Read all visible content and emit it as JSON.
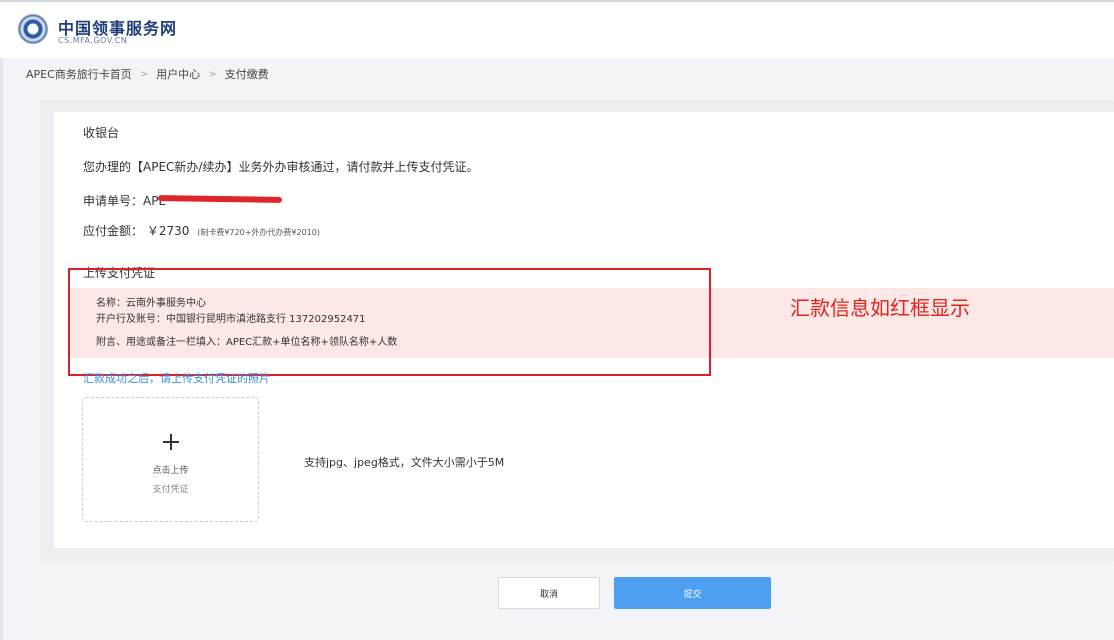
{
  "header": {
    "site_title": "中国领事服务网",
    "site_subtitle": "CS.MFA.GOV.CN"
  },
  "breadcrumb": [
    "APEC商务旅行卡首页",
    "用户中心",
    "支付缴费"
  ],
  "page": {
    "section_title": "收银台",
    "notice": "您办理的【APEC新办/续办】业务外办审核通过，请付款并上传支付凭证。",
    "order_label": "申请单号：APE",
    "amount_label": "应付金额：",
    "amount_value": "￥2730",
    "amount_detail": "(制卡费¥720+外办代办费¥2010)",
    "upload_section_title": "上传支付凭证"
  },
  "bank_info": {
    "name": "名称：云南外事服务中心",
    "account": "开户行及账号：中国银行昆明市滇池路支行  137202952471",
    "memo": "附言、用途或备注一栏填入：APEC汇款+单位名称+领队名称+人数"
  },
  "annotation": "汇款信息如红框显示",
  "upload": {
    "hint": "汇款成功之后，请上传支付凭证的照片",
    "box_label": "点击上传",
    "box_sublabel": "支付凭证",
    "format_hint": "支持jpg、jpeg格式，文件大小需小于5M"
  },
  "buttons": {
    "cancel": "取消",
    "submit": "提交"
  },
  "colors": {
    "accent_blue": "#4f9ff0",
    "annotation_red": "#e1251b",
    "highlight_pink": "#fde8e8"
  }
}
